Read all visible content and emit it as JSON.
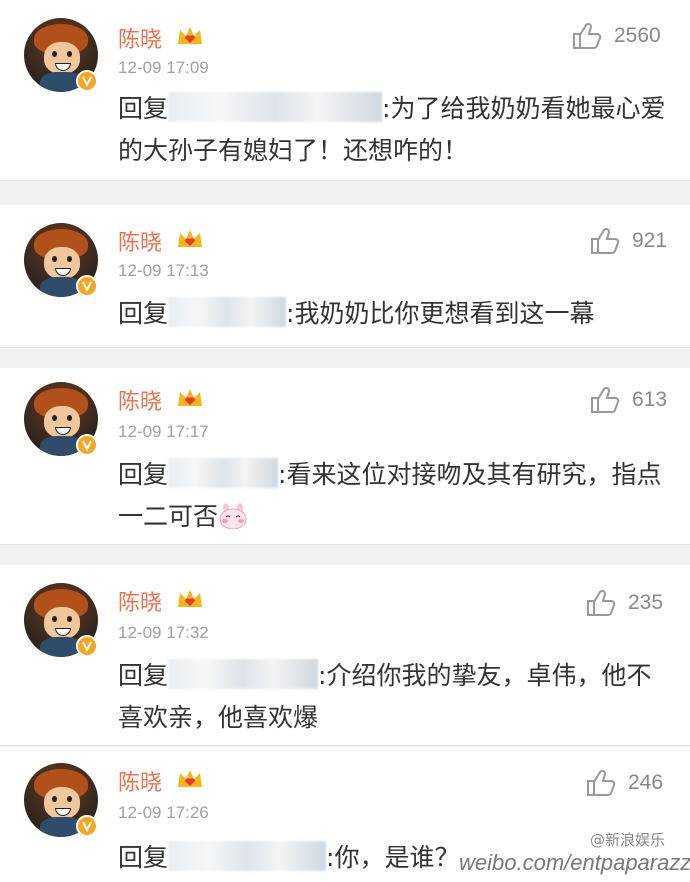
{
  "comments": [
    {
      "username": "陈晓",
      "time": "12-09 17:09",
      "likes": "2560",
      "reply_prefix": "回复",
      "reply_text": ":为了给我奶奶看她最心爱的大孙子有媳妇了！还想咋的！"
    },
    {
      "username": "陈晓",
      "time": "12-09 17:13",
      "likes": "921",
      "reply_prefix": "回复",
      "reply_text": ":我奶奶比你更想看到这一幕"
    },
    {
      "username": "陈晓",
      "time": "12-09 17:17",
      "likes": "613",
      "reply_prefix": "回复",
      "reply_text": ":看来这位对接吻及其有研究，指点一二可否"
    },
    {
      "username": "陈晓",
      "time": "12-09 17:32",
      "likes": "235",
      "reply_prefix": "回复",
      "reply_text": ":介绍你我的挚友，卓伟，他不喜欢亲，他喜欢爆"
    },
    {
      "username": "陈晓",
      "time": "12-09 17:26",
      "likes": "246",
      "reply_prefix": "回复",
      "reply_text": ":你，是谁？"
    }
  ],
  "watermark": {
    "logo": "@新浪娱乐",
    "url": "weibo.com/entpaparazzi"
  },
  "colors": {
    "username": "#eb7350",
    "meta": "#a0a0a0",
    "badge": "#f5a623"
  }
}
